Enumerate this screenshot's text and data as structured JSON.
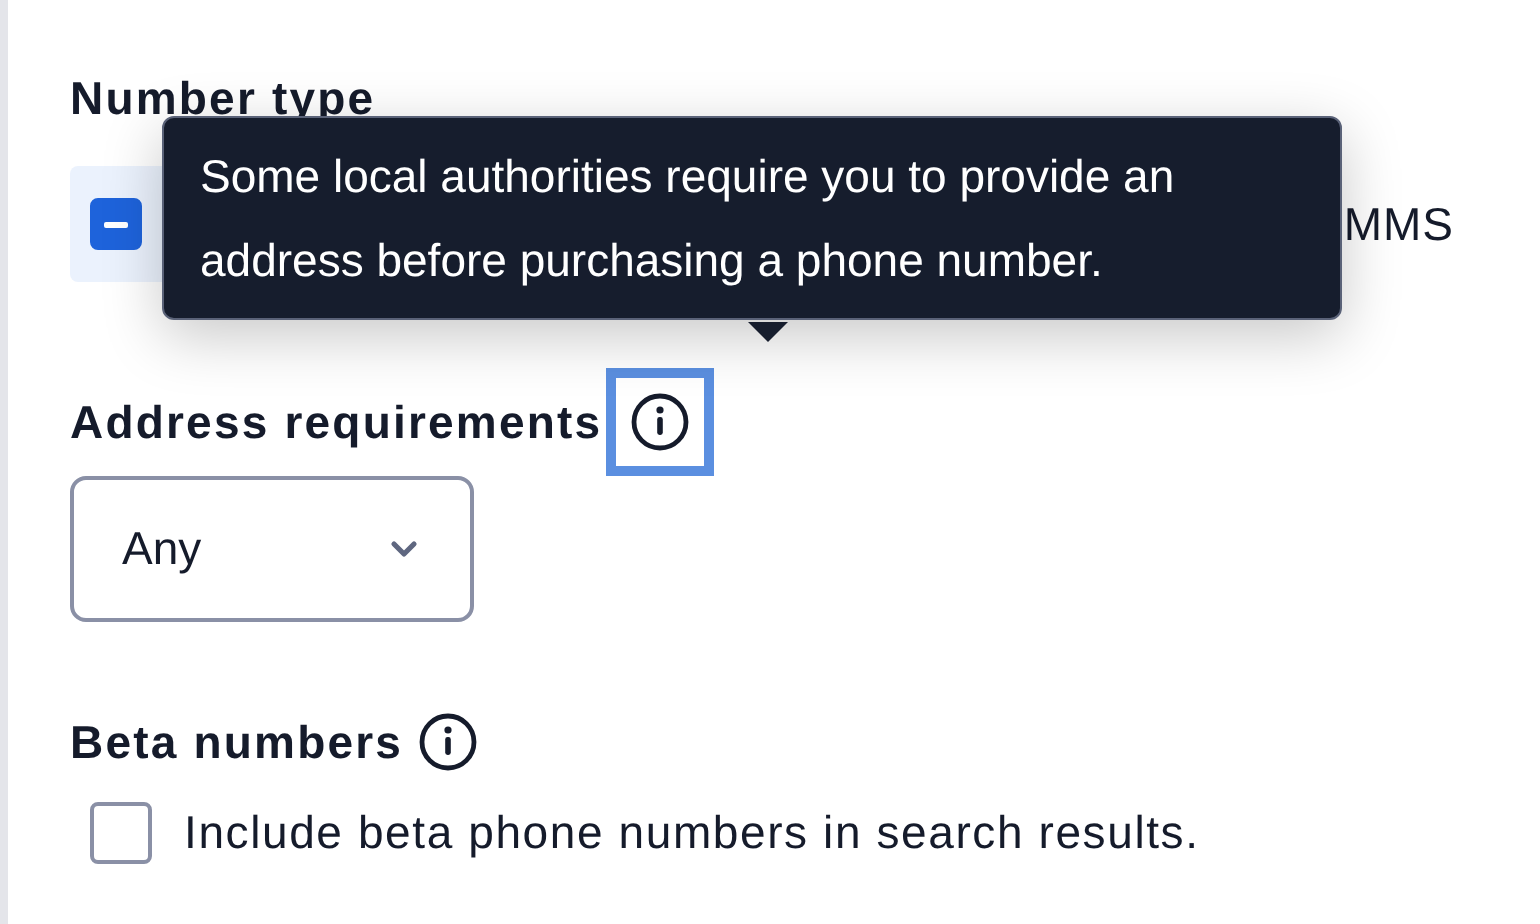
{
  "number_type": {
    "label": "Number type",
    "select_all": {
      "indeterminate": true
    },
    "option_text": "MMS"
  },
  "tooltip": {
    "text": "Some local authorities require you to provide an address before purchasing a phone number."
  },
  "address_requirements": {
    "label": "Address requirements",
    "info_focused": true,
    "select": {
      "value": "Any"
    }
  },
  "beta_numbers": {
    "label": "Beta numbers",
    "checkbox": {
      "label": "Include beta phone numbers in search results.",
      "checked": false
    }
  }
}
